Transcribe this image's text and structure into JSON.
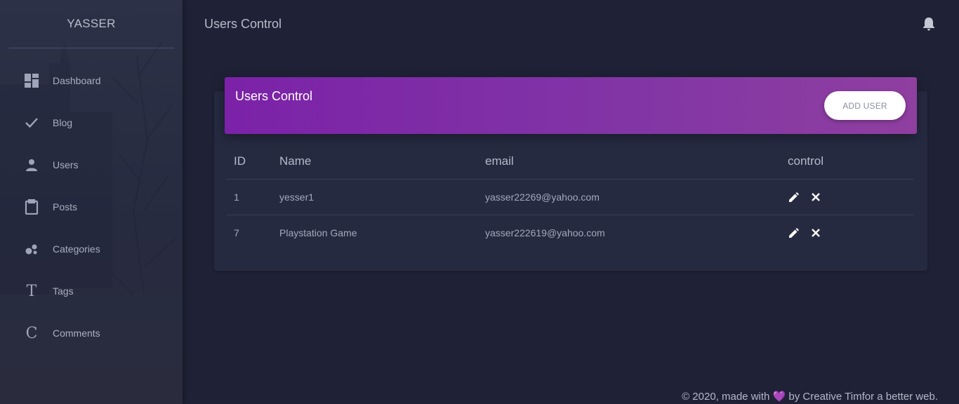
{
  "sidebar": {
    "brand": "YASSER",
    "items": [
      {
        "label": "Dashboard",
        "icon": "dashboard-icon"
      },
      {
        "label": "Blog",
        "icon": "check-icon"
      },
      {
        "label": "Users",
        "icon": "person-icon"
      },
      {
        "label": "Posts",
        "icon": "clipboard-icon"
      },
      {
        "label": "Categories",
        "icon": "bubbles-icon"
      },
      {
        "label": "Tags",
        "icon": "letter-t-icon",
        "glyph": "T"
      },
      {
        "label": "Comments",
        "icon": "letter-c-icon",
        "glyph": "C"
      }
    ]
  },
  "header": {
    "title": "Users Control",
    "notification_icon": "bell-icon"
  },
  "card": {
    "title": "Users Control",
    "add_button": "ADD USER",
    "accent": "#7b22a8",
    "columns": [
      "ID",
      "Name",
      "email",
      "control"
    ],
    "rows": [
      {
        "id": "1",
        "name": "yesser1",
        "email": "yasser22269@yahoo.com"
      },
      {
        "id": "7",
        "name": "Playstation Game",
        "email": "yasser222619@yahoo.com"
      }
    ]
  },
  "footer": {
    "prefix": "© 2020, made with",
    "heart": "💜",
    "suffix": "by Creative Timfor a better web."
  }
}
